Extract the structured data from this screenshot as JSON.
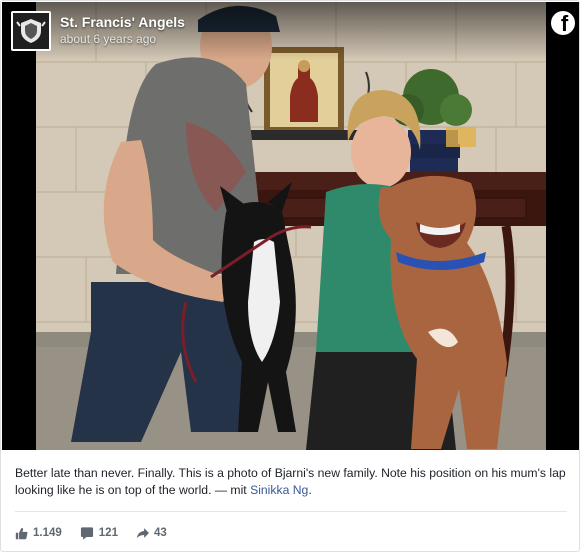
{
  "post": {
    "page_name": "St. Francis' Angels",
    "timestamp": "about 6 years ago",
    "caption_text": "Better late than never. Finally. This is a photo of Bjarni's new family. Note his position on his mum's lap looking like he is on top of the world. — mit ",
    "caption_tag": "Sinikka Ng",
    "caption_end": "."
  },
  "stats": {
    "likes": "1.149",
    "comments": "121",
    "shares": "43"
  },
  "icons": {
    "brand": "facebook-icon",
    "logo": "page-logo-crest",
    "like": "thumbs-up-icon",
    "comment": "comment-icon",
    "share": "share-arrow-icon"
  },
  "colors": {
    "link": "#385898",
    "text": "#1d2129",
    "meta": "#606770"
  }
}
